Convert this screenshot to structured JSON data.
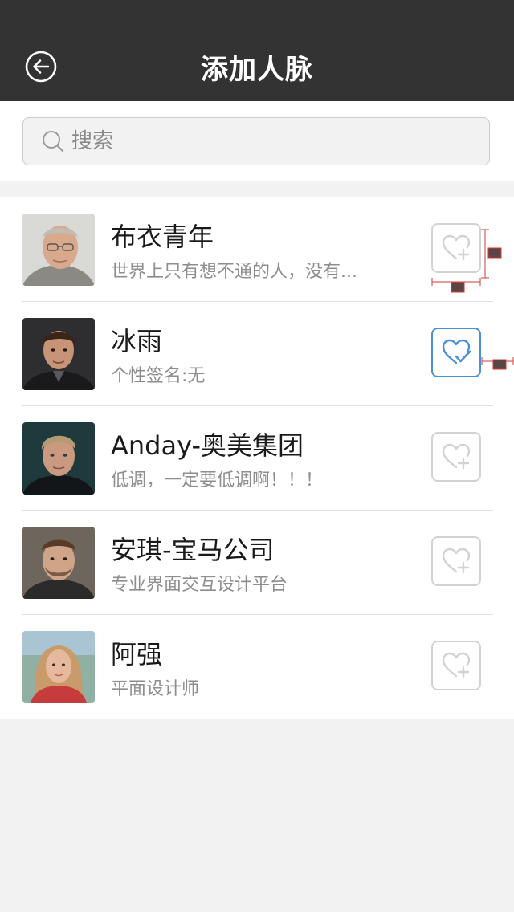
{
  "header": {
    "title": "添加人脉"
  },
  "search": {
    "placeholder": "搜索"
  },
  "contacts": [
    {
      "name": "布衣青年",
      "signature": "世界上只有想不通的人，没有...",
      "followed": false
    },
    {
      "name": "冰雨",
      "signature": "个性签名:无",
      "followed": true
    },
    {
      "name": "Anday-奥美集团",
      "signature": "低调，一定要低调啊！！！",
      "followed": false
    },
    {
      "name": "安琪-宝马公司",
      "signature": "专业界面交互设计平台",
      "followed": false
    },
    {
      "name": "阿强",
      "signature": "平面设计师",
      "followed": false
    }
  ],
  "colors": {
    "header_bg": "#333333",
    "follow_active": "#4a90d9",
    "follow_inactive": "#d2d2d2",
    "page_bg": "#f2f2f2"
  },
  "icons": {
    "back": "back-arrow-circle-icon",
    "search": "search-icon",
    "follow": "heart-plus-icon",
    "followed": "heart-check-icon"
  }
}
